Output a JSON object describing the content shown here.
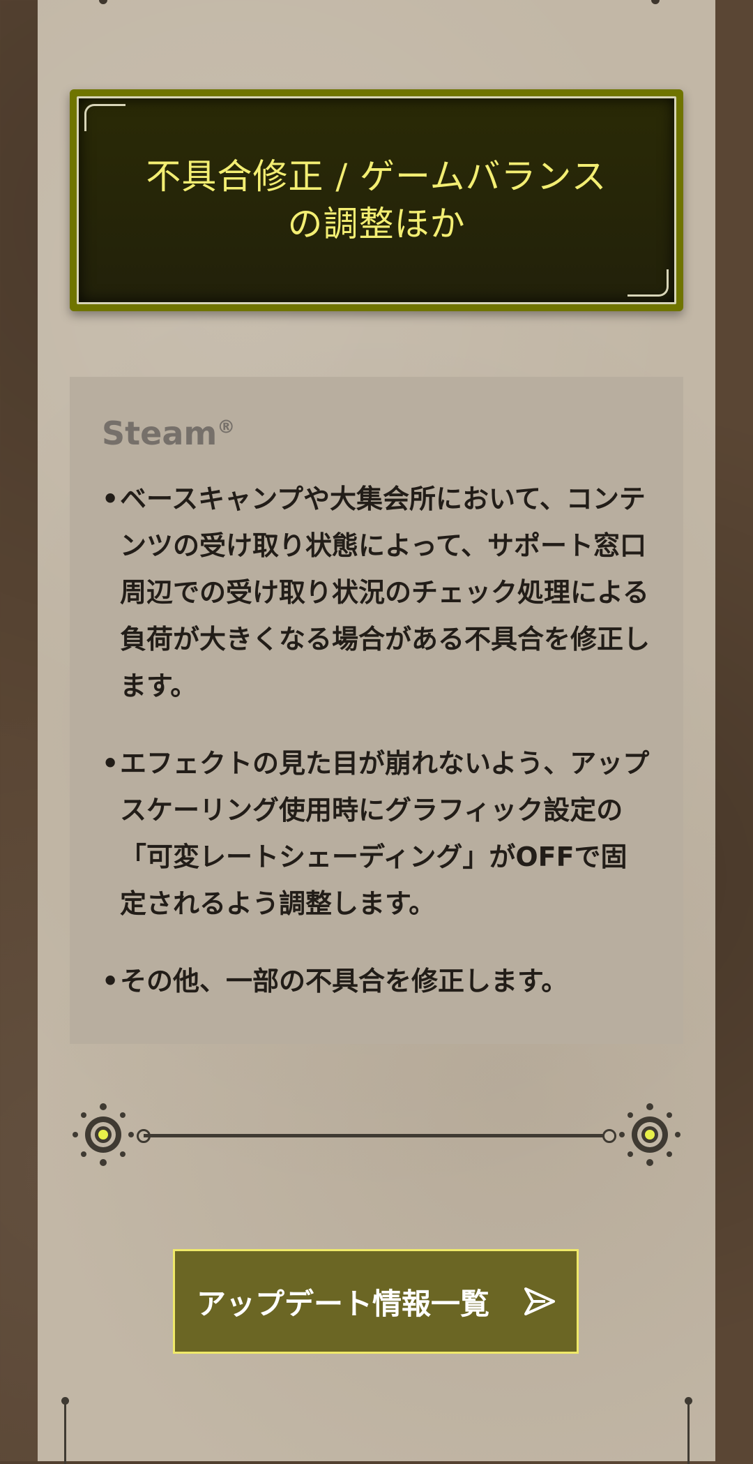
{
  "title_card": {
    "title": "不具合修正 / ゲームバランス\nの調整ほか"
  },
  "content": {
    "platform": "Steam",
    "platform_mark": "®",
    "items": [
      "ベースキャンプや大集会所において、コンテンツの受け取り状態によって、サポート窓口周辺での受け取り状況のチェック処理による負荷が大きくなる場合がある不具合を修正します。",
      "エフェクトの見た目が崩れないよう、アップスケーリング使用時にグラフィック設定の「可変レートシェーディング」がOFFで固定されるよう調整します。",
      "その他、一部の不具合を修正します。"
    ]
  },
  "divider": {
    "icon": "eye-emblem-icon",
    "accent": "#e8f04a"
  },
  "button": {
    "label": "アップデート情報一覧",
    "icon": "arrow-send-icon"
  },
  "colors": {
    "title_text": "#f3ee73",
    "title_frame": "#6f7400",
    "button_bg": "#6b6624",
    "button_border": "#efe96a"
  }
}
